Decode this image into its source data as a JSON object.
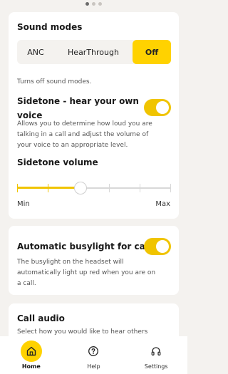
{
  "pager": {
    "pages": 3,
    "current": 1
  },
  "sound_modes": {
    "title": "Sound modes",
    "options": [
      "ANC",
      "HearThrough",
      "Off"
    ],
    "selected": "Off",
    "description": "Turns off sound modes."
  },
  "sidetone": {
    "title_line1": "Sidetone - hear your own",
    "title_line2": "voice",
    "enabled": true,
    "description_lines": [
      "Allows you to determine how loud you are",
      "talking in a call and adjust the volume of",
      "your voice to an appropriate level."
    ]
  },
  "sidetone_volume": {
    "title": "Sidetone volume",
    "min_label": "Min",
    "max_label": "Max",
    "steps": 6,
    "value_fraction": 0.4
  },
  "busylight": {
    "title": "Automatic busylight for calls",
    "enabled": true,
    "description_lines": [
      "The busylight on the headset will",
      "automatically light up red when you are on",
      "a call."
    ]
  },
  "call_audio": {
    "title": "Call audio",
    "description": "Select how you would like to hear others"
  },
  "nav": {
    "items": [
      {
        "label": "Home",
        "icon": "home-icon",
        "active": true
      },
      {
        "label": "Help",
        "icon": "help-icon",
        "active": false
      },
      {
        "label": "Settings",
        "icon": "headphones-icon",
        "active": false
      }
    ]
  },
  "colors": {
    "accent": "#ffd200",
    "toggle_on": "#f0c400",
    "background": "#f4f2ef"
  }
}
